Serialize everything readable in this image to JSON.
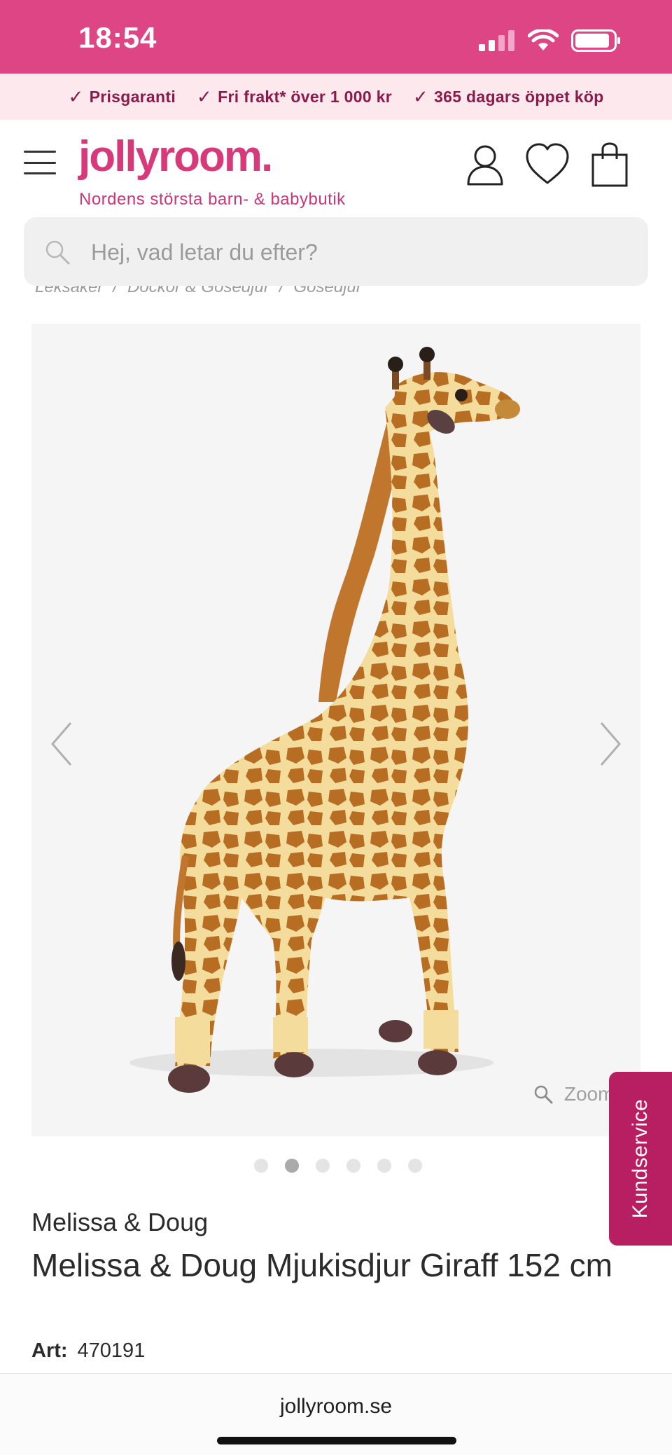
{
  "status_bar": {
    "time": "18:54"
  },
  "usp": [
    {
      "label": "Prisgaranti"
    },
    {
      "label": "Fri frakt* över 1 000 kr"
    },
    {
      "label": "365 dagars öppet köp"
    }
  ],
  "header": {
    "logo": "jollyroom.",
    "tagline": "Nordens största barn- & babybutik",
    "brand_color": "#d63a7b"
  },
  "search": {
    "placeholder": "Hej, vad letar du efter?"
  },
  "breadcrumb": [
    "Leksaker",
    "/",
    "Dockor & Gosedjur",
    "/",
    "Gosedjur"
  ],
  "gallery": {
    "zoom_label": "Zooma",
    "dots_count": 6,
    "active_dot": 2
  },
  "kundservice": {
    "label": "Kundservice"
  },
  "product": {
    "brand": "Melissa & Doug",
    "title": "Melissa & Doug Mjukisdjur Giraff 152 cm",
    "art_label": "Art:",
    "art_number": "470191"
  },
  "browser": {
    "url": "jollyroom.se"
  }
}
